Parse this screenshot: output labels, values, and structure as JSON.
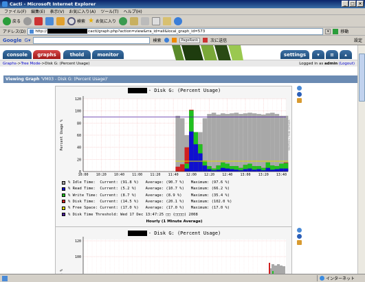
{
  "window": {
    "title": "Cacti - Microsoft Internet Explorer"
  },
  "menu": [
    "ファイル(F)",
    "編集(E)",
    "表示(V)",
    "お気に入り(A)",
    "ツール(T)",
    "ヘルプ(H)"
  ],
  "toolbar": {
    "back": "戻る",
    "search": "検索",
    "favorites": "お気に入り"
  },
  "address": {
    "label": "アドレス(D)",
    "prefix": "http://",
    "suffix": "cacti/graph.php?action=view&rra_id=all&local_graph_id=573",
    "go": "移動"
  },
  "google": {
    "label": "Google",
    "search_btn": "検索",
    "pagerank": "PageRank",
    "next_btn": "次に送信",
    "settings": "設定"
  },
  "tabs": {
    "console": "console",
    "graphs": "graphs",
    "thold": "thold",
    "monitor": "monitor",
    "settings": "settings"
  },
  "breadcrumb": {
    "graphs": "Graphs",
    "tree": "Tree Mode",
    "sep": " -> ",
    "current": "Disk G: (Percent Usage)",
    "logged_pre": "Logged in as ",
    "user": "admin",
    "logout": "(Logout)"
  },
  "viewing": {
    "label": "Viewing Graph",
    "title": "'VM03 - Disk G: (Percent Usage)'"
  },
  "graph1": {
    "title": "- Disk G: (Percent Usage)",
    "ylabel": "Percent Usage %",
    "yticks": [
      "0",
      "20",
      "40",
      "60",
      "80",
      "100",
      "120"
    ],
    "xticks": [
      "10:00",
      "10:20",
      "10:40",
      "11:00",
      "11:20",
      "11:40",
      "12:00",
      "12:20",
      "12:40",
      "13:00",
      "13:20",
      "13:40"
    ],
    "rrdtool": "RRDTOOL / TOBI OETIKER",
    "legend": [
      {
        "name": "% Idle Time:",
        "text": "Current: (91.8 %)   Average: (90.7 %)   Maximum: (97.6 %)",
        "color": "#a8a8a8"
      },
      {
        "name": "% Read Time:",
        "text": "Current: (5.2 %)    Average: (10.7 %)   Maximum: (66.2 %)",
        "color": "#1010d0"
      },
      {
        "name": "% Write Time:",
        "text": "Current: (8.7 %)    Average: (8.9 %)    Maximum: (35.4 %)",
        "color": "#20c020"
      },
      {
        "name": "% Disk Time:",
        "text": "Current: (14.5 %)   Average: (20.1 %)   Maximum: (102.0 %)",
        "color": "#d02020"
      },
      {
        "name": "% Free Space:",
        "text": "Current: (17.0 %)   Average: (17.0 %)   Maximum: (17.0 %)",
        "color": "#e0e000"
      },
      {
        "name": "% Disk Time Threshold:",
        "text": "Wed 17 Dec 13:47:25 □□ (□□□□) 2008",
        "color": "#5020a0"
      }
    ],
    "caption": "Hourly (1 Minute Average)"
  },
  "graph2": {
    "title": "- Disk G: (Percent Usage)",
    "ylabel": "Usage %",
    "yticks": [
      "100",
      "120"
    ]
  },
  "status": {
    "zone": "インターネット"
  },
  "chart_data": {
    "type": "area",
    "title": "- Disk G: (Percent Usage)",
    "ylabel": "Percent Usage %",
    "ylim": [
      0,
      120
    ],
    "x": [
      "11:45",
      "11:50",
      "11:55",
      "12:00",
      "12:05",
      "12:10",
      "12:15",
      "12:20",
      "12:25",
      "12:30",
      "12:35",
      "12:40",
      "12:45",
      "12:50",
      "12:55",
      "13:00",
      "13:05",
      "13:10",
      "13:15",
      "13:20",
      "13:25",
      "13:30",
      "13:35",
      "13:40",
      "13:45"
    ],
    "series": [
      {
        "name": "% Idle Time",
        "values": [
          92,
          88,
          60,
          95,
          50,
          65,
          88,
          95,
          97,
          94,
          96,
          95,
          96,
          97,
          95,
          96,
          97,
          96,
          95,
          94,
          96,
          97,
          95,
          92,
          92
        ]
      },
      {
        "name": "% Read Time",
        "values": [
          0,
          0,
          5,
          66,
          45,
          30,
          10,
          4,
          2,
          3,
          6,
          5,
          4,
          3,
          2,
          4,
          5,
          3,
          4,
          2,
          6,
          3,
          4,
          5,
          5
        ]
      },
      {
        "name": "% Write Time",
        "values": [
          0,
          0,
          8,
          35,
          20,
          15,
          8,
          5,
          3,
          7,
          9,
          8,
          5,
          6,
          4,
          7,
          8,
          6,
          5,
          4,
          9,
          7,
          5,
          8,
          9
        ]
      },
      {
        "name": "% Disk Time",
        "values": [
          8,
          12,
          40,
          102,
          65,
          45,
          18,
          9,
          5,
          10,
          15,
          13,
          9,
          9,
          6,
          11,
          13,
          9,
          9,
          6,
          15,
          10,
          9,
          13,
          15
        ]
      },
      {
        "name": "% Free Space",
        "values": [
          17,
          17,
          17,
          17,
          17,
          17,
          17,
          17,
          17,
          17,
          17,
          17,
          17,
          17,
          17,
          17,
          17,
          17,
          17,
          17,
          17,
          17,
          17,
          17,
          17
        ]
      }
    ],
    "threshold": 90
  }
}
